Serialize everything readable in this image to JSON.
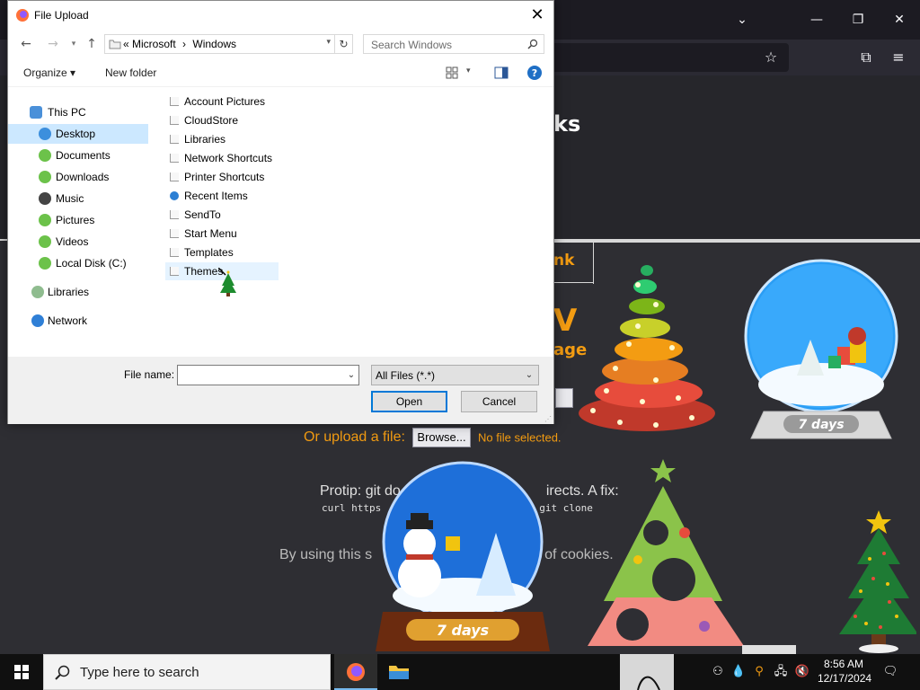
{
  "dialog": {
    "title": "File Upload",
    "address": {
      "path_sep": "«",
      "crumbs": [
        "Microsoft",
        "Windows"
      ],
      "chevron": "›"
    },
    "search_placeholder": "Search Windows",
    "commands": {
      "organize": "Organize ▾",
      "new_folder": "New folder"
    },
    "nav": [
      {
        "label": "This PC",
        "icon": "computer-icon"
      },
      {
        "label": "Desktop",
        "icon": "desktop-icon",
        "selected": true
      },
      {
        "label": "Documents",
        "icon": "documents-icon"
      },
      {
        "label": "Downloads",
        "icon": "downloads-icon"
      },
      {
        "label": "Music",
        "icon": "music-icon"
      },
      {
        "label": "Pictures",
        "icon": "pictures-icon"
      },
      {
        "label": "Videos",
        "icon": "videos-icon"
      },
      {
        "label": "Local Disk (C:)",
        "icon": "disk-icon"
      },
      {
        "label": "Libraries",
        "icon": "libraries-icon"
      },
      {
        "label": "Network",
        "icon": "network-icon"
      }
    ],
    "files": [
      {
        "name": "Account Pictures"
      },
      {
        "name": "CloudStore"
      },
      {
        "name": "Libraries"
      },
      {
        "name": "Network Shortcuts"
      },
      {
        "name": "Printer Shortcuts"
      },
      {
        "name": "Recent Items"
      },
      {
        "name": "SendTo"
      },
      {
        "name": "Start Menu"
      },
      {
        "name": "Templates"
      },
      {
        "name": "Themes",
        "hovered": true
      }
    ],
    "file_name_label": "File name:",
    "file_name_value": "",
    "file_type": "All Files (*.*)",
    "open_label": "Open",
    "cancel_label": "Cancel"
  },
  "page": {
    "title_fragment": "ks",
    "link_fragment": "nk",
    "big_fragment": "V",
    "age_fragment": "age",
    "upload_label": "Or upload a file:",
    "browse_label": "Browse...",
    "no_file": "No file selected.",
    "protip_left": "Protip: git do",
    "protip_right": "irects. A fix:",
    "code_left": "curl https",
    "code_right": "git clone",
    "cookies_left": "By using this s",
    "cookies_right": "of cookies.",
    "snow_globe_label": "7 days"
  },
  "taskbar": {
    "search_placeholder": "Type here to search",
    "time": "8:56 AM",
    "date": "12/17/2024"
  },
  "colors": {
    "accent": "#0078d7",
    "page_orange": "#f39c12",
    "selection": "#cce8ff"
  }
}
